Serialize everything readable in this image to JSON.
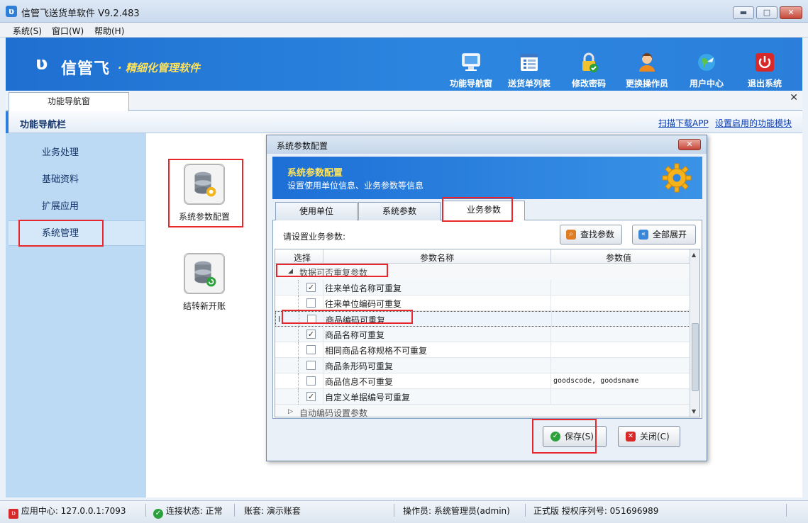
{
  "window": {
    "title": "信管飞送货单软件 V9.2.483",
    "app_icon_glyph": "ʋ",
    "minimize_glyph": "▬",
    "maximize_glyph": "□",
    "close_glyph": "✕"
  },
  "menu": [
    "系统(S)",
    "窗口(W)",
    "帮助(H)"
  ],
  "banner": {
    "logo_glyph": "ʋ",
    "logo_text": "信管飞",
    "slogan": "· 精细化管理软件",
    "tools": [
      {
        "label": "功能导航窗",
        "icon": "monitor-icon"
      },
      {
        "label": "送货单列表",
        "icon": "list-icon"
      },
      {
        "label": "修改密码",
        "icon": "lock-icon"
      },
      {
        "label": "更换操作员",
        "icon": "user-icon"
      },
      {
        "label": "用户中心",
        "icon": "globe-icon"
      },
      {
        "label": "退出系统",
        "icon": "power-icon"
      }
    ]
  },
  "doc_tab": "功能导航窗",
  "doc_close": "✕",
  "nav": {
    "title": "功能导航栏",
    "links": [
      "扫描下载APP",
      "设置启用的功能模块"
    ]
  },
  "sidebar": {
    "items": [
      "业务处理",
      "基础资料",
      "扩展应用",
      "系统管理"
    ],
    "active": "系统管理"
  },
  "modules": [
    {
      "label": "系统参数配置",
      "icon": "database-gear-icon"
    },
    {
      "label": "结转新开账",
      "icon": "database-refresh-icon"
    }
  ],
  "dialog": {
    "title": "系统参数配置",
    "close_glyph": "✕",
    "banner_title": "系统参数配置",
    "banner_subtitle": "设置使用单位信息、业务参数等信息",
    "tabs": [
      "使用单位",
      "系统参数",
      "业务参数"
    ],
    "active_tab": "业务参数",
    "prompt": "请设置业务参数:",
    "find_button": "查找参数",
    "expand_button": "全部展开",
    "grid": {
      "headers": [
        "选择",
        "参数名称",
        "参数值"
      ],
      "group1": "数据可否重复参数",
      "group2": "自动编码设置参数",
      "rows": [
        {
          "name": "往来单位名称可重复",
          "checked": true,
          "value": ""
        },
        {
          "name": "往来单位编码可重复",
          "checked": false,
          "value": ""
        },
        {
          "name": "商品编码可重复",
          "checked": false,
          "value": ""
        },
        {
          "name": "商品名称可重复",
          "checked": true,
          "value": ""
        },
        {
          "name": "相同商品名称规格不可重复",
          "checked": false,
          "value": ""
        },
        {
          "name": "商品条形码可重复",
          "checked": false,
          "value": ""
        },
        {
          "name": "商品信息不可重复",
          "checked": false,
          "value": "goodscode, goodsname"
        },
        {
          "name": "自定义单据编号可重复",
          "checked": true,
          "value": ""
        }
      ],
      "cursor_glyph": "I",
      "expanded_glyph": "◢",
      "collapsed_glyph": "▷",
      "check_glyph": "✓"
    },
    "save_button": "保存(S)",
    "close_button": "关闭(C)"
  },
  "status": {
    "app_center": "应用中心: 127.0.0.1:7093",
    "connection": "连接状态: 正常",
    "account": "账套: 演示账套",
    "operator": "操作员: 系统管理员(admin)",
    "license": "正式版 授权序列号: 051696989"
  },
  "colors": {
    "highlight": "#e8272c",
    "banner": "#2c86e0",
    "slogan": "#ffe25c"
  }
}
